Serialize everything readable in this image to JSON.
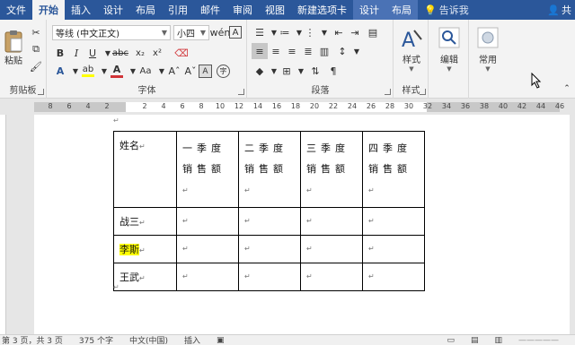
{
  "tabs": [
    {
      "label": "文件",
      "active": false,
      "contextual": false
    },
    {
      "label": "开始",
      "active": true,
      "contextual": false
    },
    {
      "label": "插入",
      "active": false,
      "contextual": false
    },
    {
      "label": "设计",
      "active": false,
      "contextual": false
    },
    {
      "label": "布局",
      "active": false,
      "contextual": false
    },
    {
      "label": "引用",
      "active": false,
      "contextual": false
    },
    {
      "label": "邮件",
      "active": false,
      "contextual": false
    },
    {
      "label": "审阅",
      "active": false,
      "contextual": false
    },
    {
      "label": "视图",
      "active": false,
      "contextual": false
    },
    {
      "label": "新建选项卡",
      "active": false,
      "contextual": false
    },
    {
      "label": "设计",
      "active": false,
      "contextual": true
    },
    {
      "label": "布局",
      "active": false,
      "contextual": true
    }
  ],
  "tell_me": "告诉我",
  "share": "共",
  "clipboard": {
    "paste_label": "粘贴",
    "group_label": "剪贴板"
  },
  "font": {
    "name": "等线 (中文正文)",
    "size": "小四",
    "group_label": "字体",
    "font_color": "#d13438",
    "highlight_color": "#ffff00"
  },
  "paragraph": {
    "group_label": "段落"
  },
  "styles": {
    "button_label": "样式",
    "group_label": "样式"
  },
  "editing": {
    "button_label": "编辑"
  },
  "common": {
    "button_label": "常用"
  },
  "ruler_ticks": [
    "8",
    "6",
    "4",
    "2",
    "",
    "2",
    "4",
    "6",
    "8",
    "10",
    "12",
    "14",
    "16",
    "18",
    "20",
    "22",
    "24",
    "26",
    "28",
    "30",
    "32",
    "34",
    "36",
    "38",
    "40",
    "42",
    "44",
    "46"
  ],
  "table": {
    "header": [
      "姓名",
      "一季度销售额",
      "二季度销售额",
      "三季度销售额",
      "四季度销售额"
    ],
    "rows": [
      [
        "战三",
        "",
        "",
        "",
        ""
      ],
      [
        "李斯",
        "",
        "",
        "",
        ""
      ],
      [
        "王武",
        "",
        "",
        "",
        ""
      ]
    ]
  },
  "status": {
    "page": "第 3 页，共 3 页",
    "words": "375 个字",
    "language": "中文(中国)",
    "mode": "插入"
  },
  "colors": {
    "accent": "#2b579a",
    "ribbon_bg": "#f3f3f3"
  }
}
